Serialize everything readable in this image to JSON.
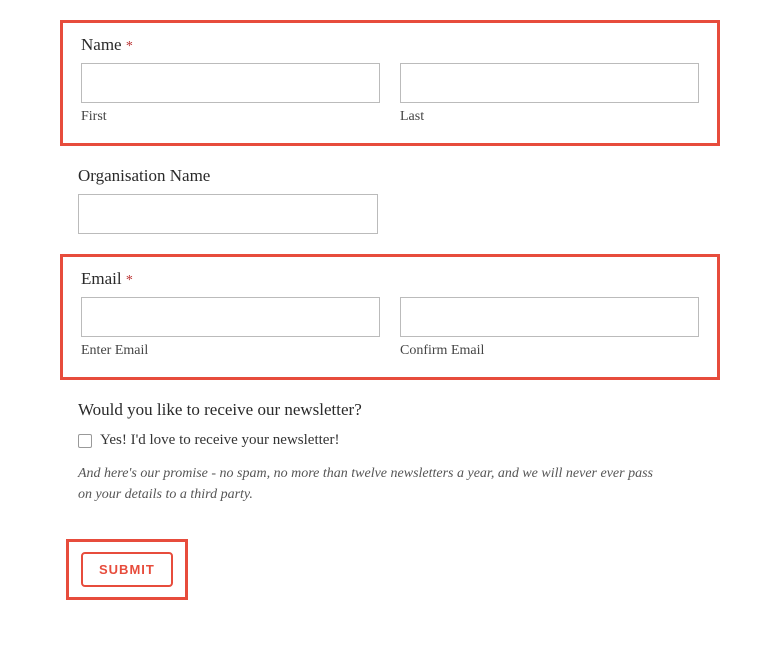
{
  "name": {
    "label": "Name",
    "required_marker": "*",
    "first_sublabel": "First",
    "last_sublabel": "Last",
    "first_value": "",
    "last_value": ""
  },
  "organisation": {
    "label": "Organisation Name",
    "value": ""
  },
  "email": {
    "label": "Email",
    "required_marker": "*",
    "enter_sublabel": "Enter Email",
    "confirm_sublabel": "Confirm Email",
    "enter_value": "",
    "confirm_value": ""
  },
  "newsletter": {
    "title": "Would you like to receive our newsletter?",
    "checkbox_label": "Yes! I'd love to receive your newsletter!",
    "checked": false,
    "promise": "And here's our promise - no spam, no more than twelve newsletters a year, and we will never ever pass on your details to a third party."
  },
  "submit": {
    "label": "SUBMIT"
  }
}
